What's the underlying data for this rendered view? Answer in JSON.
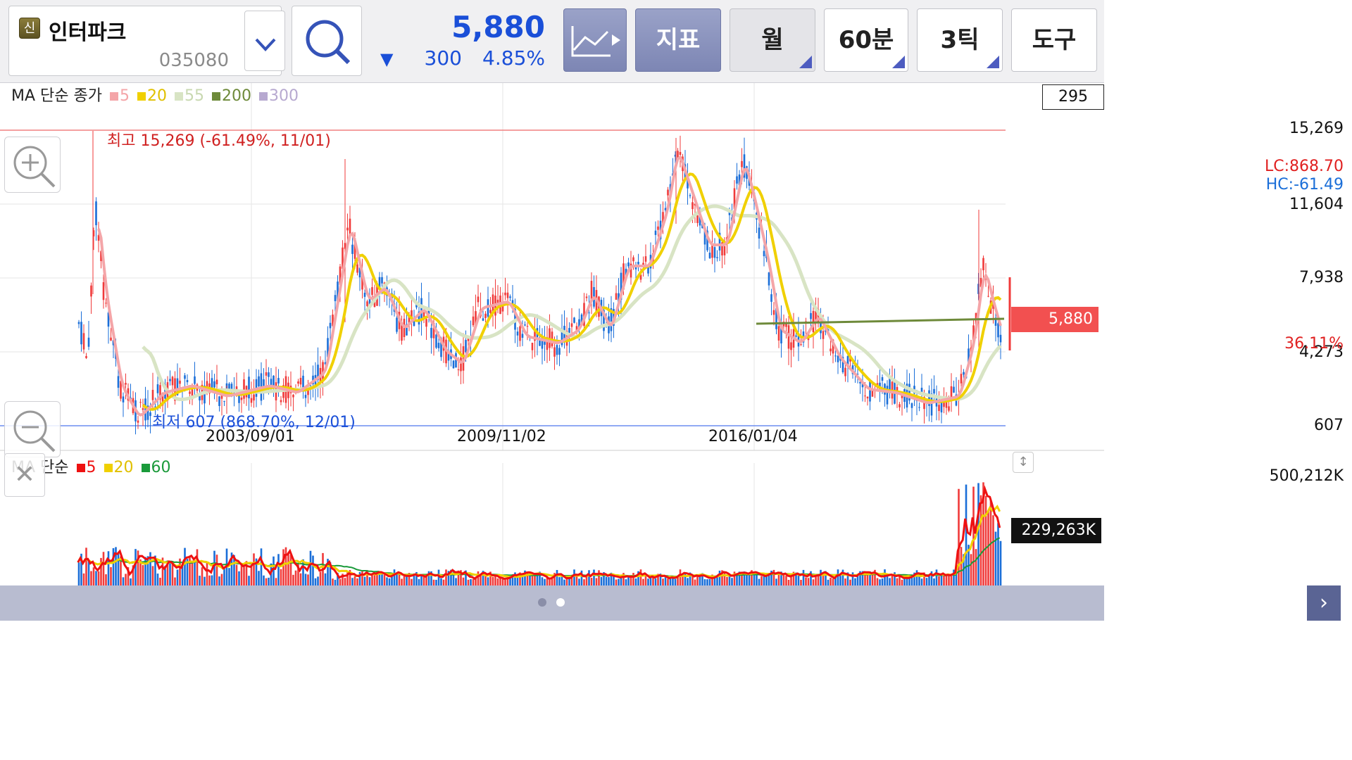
{
  "header": {
    "badge": "신",
    "stock_name": "인터파크",
    "stock_code": "035080",
    "price": "5,880",
    "change_arrow": "▼",
    "change": "300",
    "change_rate": "4.85%",
    "buttons": {
      "chart_type_icon": "line-chart-play-icon",
      "indicator": "지표",
      "period": "월",
      "minutes": "60분",
      "ticks": "3틱",
      "tools": "도구"
    }
  },
  "price_chart": {
    "legend_title": "MA 단순 종가",
    "legend_items": [
      {
        "label": "5",
        "color": "#f4a5a8"
      },
      {
        "label": "20",
        "color": "#f0d000"
      },
      {
        "label": "55",
        "color": "#d8e4c4"
      },
      {
        "label": "200",
        "color": "#6e8a3a"
      },
      {
        "label": "300",
        "color": "#b7a9d0"
      }
    ],
    "box_value": "295",
    "y_labels": [
      "15,269",
      "11,604",
      "7,938",
      "4,273",
      "607"
    ],
    "lc": "LC:868.70",
    "hc": "HC:-61.49",
    "current_tag": "5,880",
    "current_pct": "36.11%",
    "high_label": "최고 15,269 (-61.49%, 11/01)",
    "low_label": "최저 607 (868.70%, 12/01)",
    "x_labels": [
      "2003/09/01",
      "2009/11/02",
      "2016/01/04"
    ]
  },
  "volume_chart": {
    "legend_title": "MA 단순",
    "legend_items": [
      {
        "label": "5",
        "color": "#ee1111"
      },
      {
        "label": "20",
        "color": "#f0d000"
      },
      {
        "label": "60",
        "color": "#1a9a3a"
      }
    ],
    "y_top": "500,212K",
    "current_tag": "229,263K"
  },
  "colors": {
    "up": "#f03a3a",
    "down": "#1a6ed8",
    "high_line": "#f08080",
    "low_line": "#6d8df0",
    "ma5": "#f4a5a8",
    "ma20": "#f0d000",
    "ma55": "#d8e4c4",
    "ma200": "#6e8a3a"
  },
  "pager": {
    "pages": 2,
    "active": 1
  }
}
